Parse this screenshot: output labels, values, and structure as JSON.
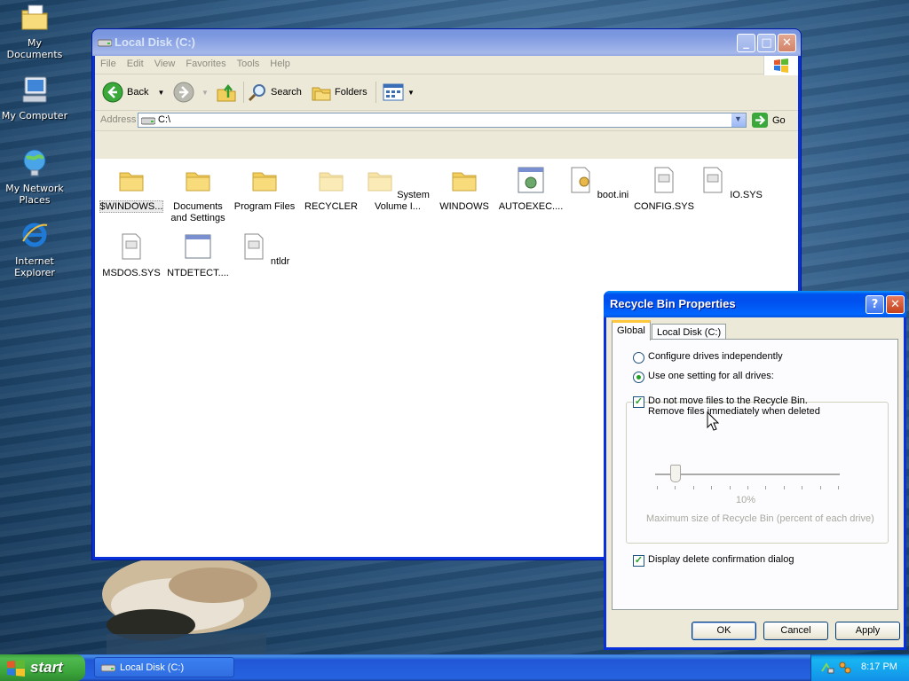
{
  "desktop": {
    "icons": [
      {
        "label": "My Documents"
      },
      {
        "label": "My Computer"
      },
      {
        "label": "My Network Places"
      },
      {
        "label": "Internet Explorer"
      }
    ]
  },
  "explorer": {
    "title": "Local Disk (C:)",
    "menu": [
      "File",
      "Edit",
      "View",
      "Favorites",
      "Tools",
      "Help"
    ],
    "toolbar": {
      "back": "Back",
      "search": "Search",
      "folders": "Folders"
    },
    "address": {
      "label": "Address",
      "value": "C:\\",
      "go": "Go"
    },
    "files": [
      {
        "label": "$WINDOWS...",
        "icon": "folder-icon"
      },
      {
        "label": "Documents and Settings",
        "icon": "folder-icon"
      },
      {
        "label": "Program Files",
        "icon": "folder-icon"
      },
      {
        "label": "RECYCLER",
        "icon": "folder-icon"
      },
      {
        "label": "System Volume I...",
        "icon": "folder-icon"
      },
      {
        "label": "WINDOWS",
        "icon": "folder-icon"
      },
      {
        "label": "AUTOEXEC....",
        "icon": "batch-file-icon"
      },
      {
        "label": "boot.ini",
        "icon": "config-file-icon"
      },
      {
        "label": "CONFIG.SYS",
        "icon": "system-file-icon"
      },
      {
        "label": "IO.SYS",
        "icon": "system-file-icon"
      },
      {
        "label": "MSDOS.SYS",
        "icon": "system-file-icon"
      },
      {
        "label": "NTDETECT....",
        "icon": "application-icon"
      },
      {
        "label": "ntldr",
        "icon": "system-file-icon"
      }
    ]
  },
  "dialog": {
    "title": "Recycle Bin Properties",
    "tabs": [
      "Global",
      "Local Disk (C:)"
    ],
    "configure_independently": "Configure drives independently",
    "use_one_setting": "Use one setting for all drives:",
    "no_move_line1": "Do not move files to the Recycle Bin.",
    "no_move_line2": "Remove files immediately when deleted",
    "no_move_checked": true,
    "slider_percent": "10%",
    "slider_value": 10,
    "slider_caption": "Maximum size of Recycle Bin (percent of each drive)",
    "display_confirmation": "Display delete confirmation dialog",
    "display_confirmation_checked": true,
    "buttons": {
      "ok": "OK",
      "cancel": "Cancel",
      "apply": "Apply"
    }
  },
  "taskbar": {
    "start": "start",
    "task": "Local Disk (C:)",
    "clock": "8:17 PM"
  },
  "colors": {
    "accent": "#0054e3",
    "start_green": "#3c9f3c",
    "tray_blue": "#139ee9"
  }
}
